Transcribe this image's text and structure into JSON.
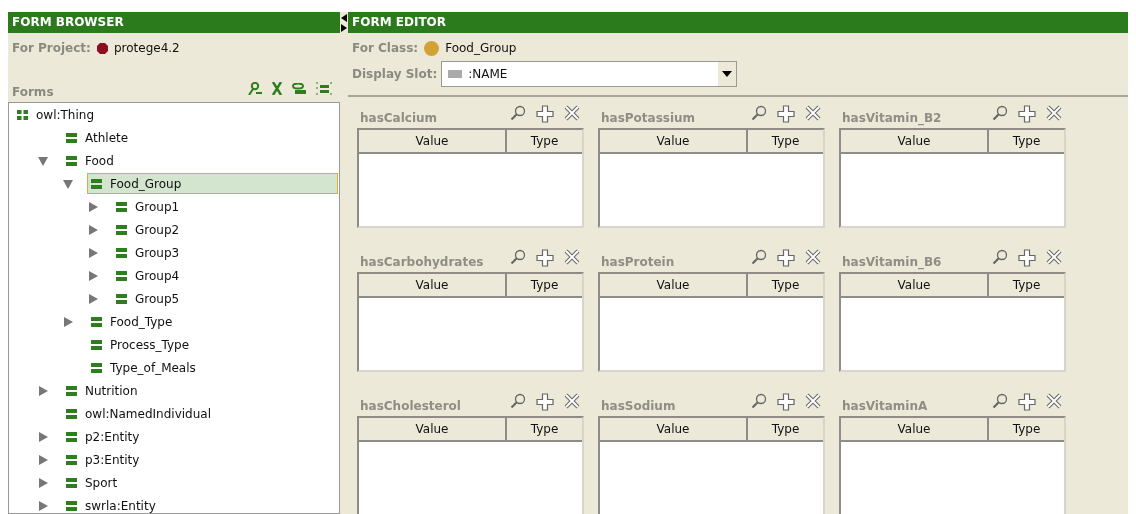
{
  "form_browser": {
    "title": "FORM BROWSER",
    "project_label": "For Project:",
    "project_name": "protege4.2",
    "forms_label": "Forms",
    "tree": {
      "root": "owl:Thing",
      "items": [
        {
          "label": "Athlete",
          "kind": "leaf",
          "selected": false
        },
        {
          "label": "Food",
          "kind": "branch",
          "expanded": true,
          "selected": false,
          "children": [
            {
              "label": "Food_Group",
              "kind": "branch",
              "expanded": true,
              "selected": true,
              "children": [
                {
                  "label": "Group1",
                  "kind": "branch",
                  "expanded": false,
                  "selected": false
                },
                {
                  "label": "Group2",
                  "kind": "branch",
                  "expanded": false,
                  "selected": false
                },
                {
                  "label": "Group3",
                  "kind": "branch",
                  "expanded": false,
                  "selected": false
                },
                {
                  "label": "Group4",
                  "kind": "branch",
                  "expanded": false,
                  "selected": false
                },
                {
                  "label": "Group5",
                  "kind": "branch",
                  "expanded": false,
                  "selected": false
                }
              ]
            },
            {
              "label": "Food_Type",
              "kind": "branch",
              "expanded": false,
              "selected": false
            },
            {
              "label": "Process_Type",
              "kind": "leaf",
              "selected": false
            },
            {
              "label": "Type_of_Meals",
              "kind": "leaf",
              "selected": false
            }
          ]
        },
        {
          "label": "Nutrition",
          "kind": "branch",
          "expanded": false,
          "selected": false
        },
        {
          "label": "owl:NamedIndividual",
          "kind": "leaf",
          "selected": false
        },
        {
          "label": "p2:Entity",
          "kind": "branch",
          "expanded": false,
          "selected": false
        },
        {
          "label": "p3:Entity",
          "kind": "branch",
          "expanded": false,
          "selected": false
        },
        {
          "label": "Sport",
          "kind": "branch",
          "expanded": false,
          "selected": false
        },
        {
          "label": "swrla:Entity",
          "kind": "branch",
          "expanded": false,
          "selected": false
        }
      ]
    }
  },
  "form_editor": {
    "title": "FORM EDITOR",
    "class_label": "For Class:",
    "class_name": "Food_Group",
    "slot_label": "Display Slot:",
    "slot_value": ":NAME",
    "widgets": [
      {
        "title": "hasCalcium",
        "columns": [
          "Value",
          "Type"
        ]
      },
      {
        "title": "hasPotassium",
        "columns": [
          "Value",
          "Type"
        ]
      },
      {
        "title": "hasVitamin_B2",
        "columns": [
          "Value",
          "Type"
        ]
      },
      {
        "title": "hasCarbohydrates",
        "columns": [
          "Value",
          "Type"
        ]
      },
      {
        "title": "hasProtein",
        "columns": [
          "Value",
          "Type"
        ]
      },
      {
        "title": "hasVitamin_B6",
        "columns": [
          "Value",
          "Type"
        ]
      },
      {
        "title": "hasCholesterol",
        "columns": [
          "Value",
          "Type"
        ]
      },
      {
        "title": "hasSodium",
        "columns": [
          "Value",
          "Type"
        ]
      },
      {
        "title": "hasVitaminA",
        "columns": [
          "Value",
          "Type"
        ]
      }
    ]
  }
}
